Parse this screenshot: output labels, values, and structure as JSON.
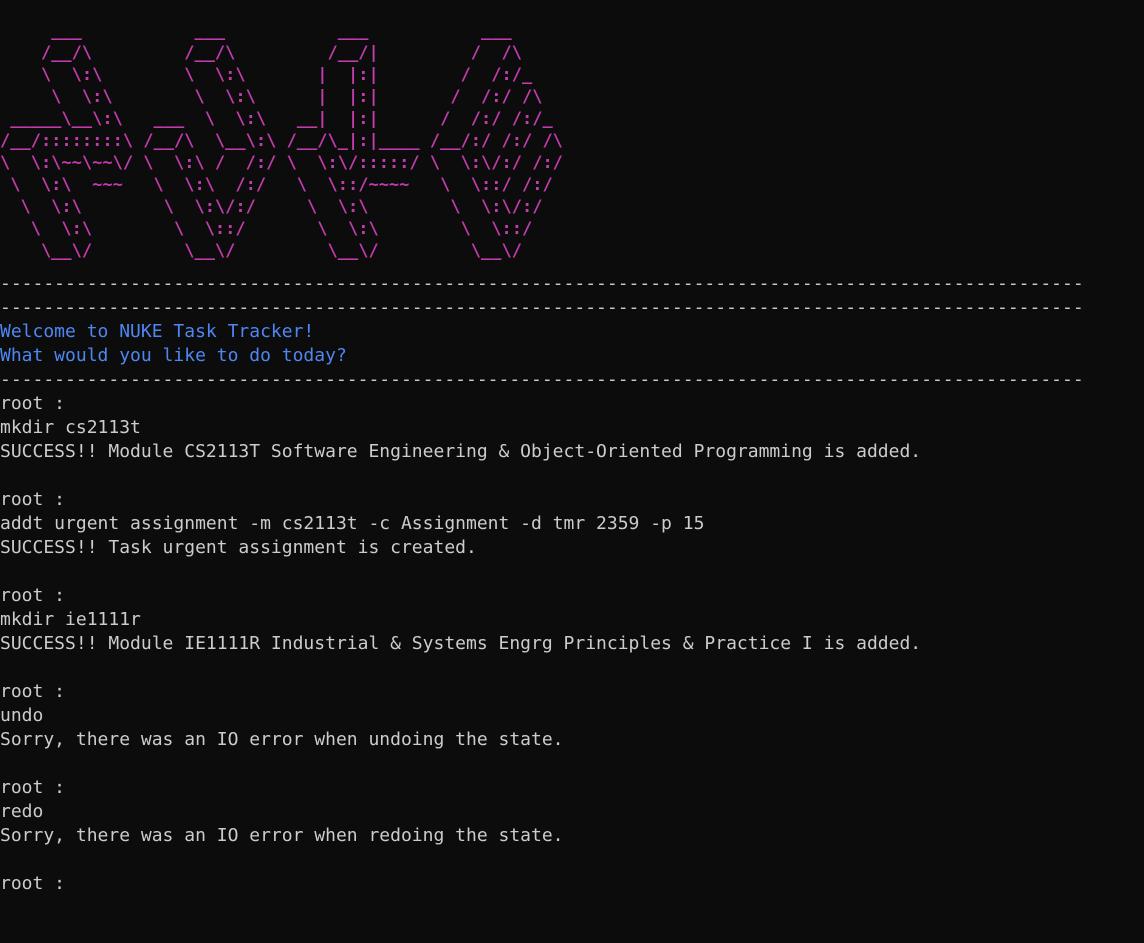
{
  "colors": {
    "background": "#0c0c0c",
    "text": "#cccccc",
    "banner": "#c33bac",
    "welcome": "#4f87f2"
  },
  "banner_ascii": "     ___           ___           ___           ___     \n    /__/\\         /__/\\         /__/|         /  /\\    \n    \\  \\:\\        \\  \\:\\       |  |:|        /  /:/_   \n     \\  \\:\\        \\  \\:\\      |  |:|       /  /:/ /\\  \n _____\\__\\:\\   ___  \\  \\:\\   __|  |:|      /  /:/ /:/_ \n/__/::::::::\\ /__/\\  \\__\\:\\ /__/\\_|:|____ /__/:/ /:/ /\\\n\\  \\:\\~~\\~~\\/ \\  \\:\\ /  /:/ \\  \\:\\/:::::/ \\  \\:\\/:/ /:/\n \\  \\:\\  ~~~   \\  \\:\\  /:/   \\  \\::/~~~~   \\  \\::/ /:/ \n  \\  \\:\\        \\  \\:\\/:/     \\  \\:\\        \\  \\:\\/:/  \n   \\  \\:\\        \\  \\::/       \\  \\:\\        \\  \\::/   \n    \\__\\/         \\__\\/         \\__\\/         \\__\\/    ",
  "divider": "----------------------------------------------------------------------------------------------------",
  "welcome": {
    "line1": "Welcome to NUKE Task Tracker!",
    "line2": "What would you like to do today?"
  },
  "session": [
    {
      "prompt": "root :",
      "command": "mkdir cs2113t",
      "output": "SUCCESS!! Module CS2113T Software Engineering & Object-Oriented Programming is added."
    },
    {
      "prompt": "root :",
      "command": "addt urgent assignment -m cs2113t -c Assignment -d tmr 2359 -p 15",
      "output": "SUCCESS!! Task urgent assignment is created."
    },
    {
      "prompt": "root :",
      "command": "mkdir ie1111r",
      "output": "SUCCESS!! Module IE1111R Industrial & Systems Engrg Principles & Practice I is added."
    },
    {
      "prompt": "root :",
      "command": "undo",
      "output": "Sorry, there was an IO error when undoing the state."
    },
    {
      "prompt": "root :",
      "command": "redo",
      "output": "Sorry, there was an IO error when redoing the state."
    }
  ],
  "final_prompt": "root :"
}
